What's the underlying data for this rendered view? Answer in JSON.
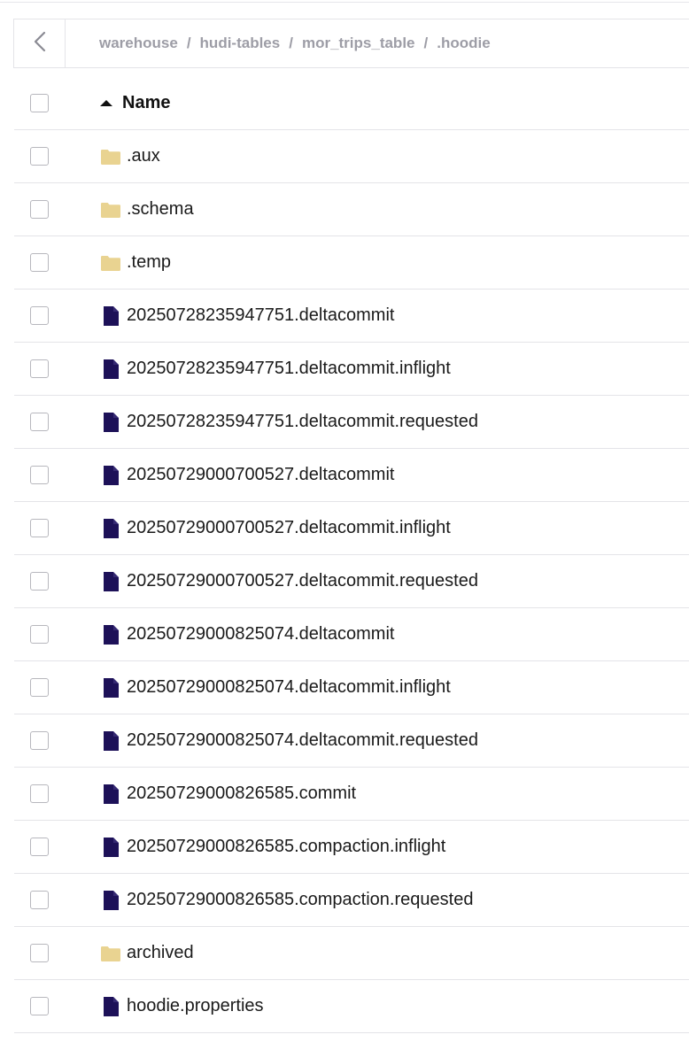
{
  "breadcrumb": {
    "items": [
      "warehouse",
      "hudi-tables",
      "mor_trips_table",
      ".hoodie"
    ],
    "separator": "/"
  },
  "table": {
    "name_header": "Name",
    "sort_direction": "ascending",
    "rows": [
      {
        "name": ".aux",
        "type": "folder"
      },
      {
        "name": ".schema",
        "type": "folder"
      },
      {
        "name": ".temp",
        "type": "folder"
      },
      {
        "name": "20250728235947751.deltacommit",
        "type": "file"
      },
      {
        "name": "20250728235947751.deltacommit.inflight",
        "type": "file"
      },
      {
        "name": "20250728235947751.deltacommit.requested",
        "type": "file"
      },
      {
        "name": "20250729000700527.deltacommit",
        "type": "file"
      },
      {
        "name": "20250729000700527.deltacommit.inflight",
        "type": "file"
      },
      {
        "name": "20250729000700527.deltacommit.requested",
        "type": "file"
      },
      {
        "name": "20250729000825074.deltacommit",
        "type": "file"
      },
      {
        "name": "20250729000825074.deltacommit.inflight",
        "type": "file"
      },
      {
        "name": "20250729000825074.deltacommit.requested",
        "type": "file"
      },
      {
        "name": "20250729000826585.commit",
        "type": "file"
      },
      {
        "name": "20250729000826585.compaction.inflight",
        "type": "file"
      },
      {
        "name": "20250729000826585.compaction.requested",
        "type": "file"
      },
      {
        "name": "archived",
        "type": "folder"
      },
      {
        "name": "hoodie.properties",
        "type": "file"
      }
    ]
  },
  "icons": {
    "back": "chevron-left-icon",
    "sort": "sort-ascending-icon",
    "folder": "folder-icon",
    "file": "file-icon"
  },
  "colors": {
    "folder": "#e9d391",
    "file": "#1d1158",
    "breadcrumb_text": "#9d9da6",
    "border": "#e4e4e8"
  }
}
